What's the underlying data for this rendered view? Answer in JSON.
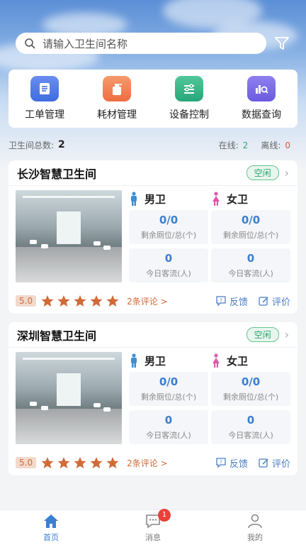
{
  "search": {
    "placeholder": "请输入卫生间名称"
  },
  "menu": [
    {
      "label": "工单管理",
      "icon": "work-order-icon",
      "color": "#3f6ce0"
    },
    {
      "label": "耗材管理",
      "icon": "supplies-icon",
      "color": "#ee6d42"
    },
    {
      "label": "设备控制",
      "icon": "device-control-icon",
      "color": "#27a77a"
    },
    {
      "label": "数据查询",
      "icon": "data-query-icon",
      "color": "#6a5ae0"
    }
  ],
  "stats": {
    "total_label": "卫生间总数:",
    "total_value": "2",
    "online_label": "在线:",
    "online_value": "2",
    "offline_label": "离线:",
    "offline_value": "0"
  },
  "toilets": [
    {
      "name": "长沙智慧卫生间",
      "status": "空闲",
      "male_label": "男卫",
      "female_label": "女卫",
      "male_stalls": "0/0",
      "female_stalls": "0/0",
      "stalls_label": "剩余厕位/总(个)",
      "male_visitors": "0",
      "female_visitors": "0",
      "visitors_label": "今日客流(人)",
      "rating": "5.0",
      "stars": 5,
      "reviews": "2条评论 >",
      "feedback": "反馈",
      "evaluate": "评价"
    },
    {
      "name": "深圳智慧卫生间",
      "status": "空闲",
      "male_label": "男卫",
      "female_label": "女卫",
      "male_stalls": "0/0",
      "female_stalls": "0/0",
      "stalls_label": "剩余厕位/总(个)",
      "male_visitors": "0",
      "female_visitors": "0",
      "visitors_label": "今日客流(人)",
      "rating": "5.0",
      "stars": 5,
      "reviews": "2条评论 >",
      "feedback": "反馈",
      "evaluate": "评价"
    }
  ],
  "tabbar": [
    {
      "label": "首页",
      "icon": "home-icon",
      "active": true
    },
    {
      "label": "消息",
      "icon": "message-icon",
      "badge": "1"
    },
    {
      "label": "我的",
      "icon": "profile-icon"
    }
  ],
  "colors": {
    "accent": "#3a7fd0",
    "online": "#2aa66b",
    "offline": "#e0573c",
    "star": "#d06a37"
  }
}
